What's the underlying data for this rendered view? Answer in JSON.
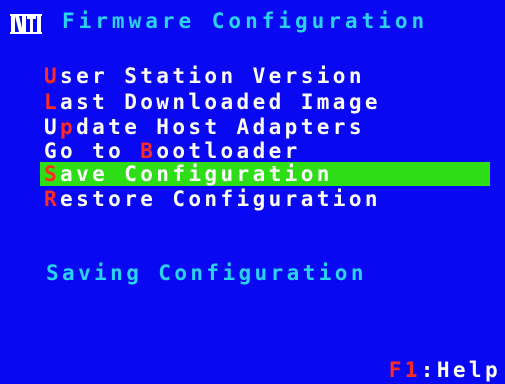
{
  "header": {
    "logo_text": "NTI",
    "title": "Firmware Configuration"
  },
  "menu": {
    "items": [
      {
        "hotkey": "U",
        "rest": "ser Station Version",
        "selected": false
      },
      {
        "hotkey": "L",
        "rest": "ast Downloaded Image",
        "selected": false
      },
      {
        "prefix": "U",
        "hotkey": "p",
        "rest": "date Host Adapters",
        "selected": false
      },
      {
        "prefix": "Go to ",
        "hotkey": "B",
        "rest": "ootloader",
        "selected": false
      },
      {
        "hotkey": "S",
        "rest": "ave Configuration",
        "selected": true
      },
      {
        "hotkey": "R",
        "rest": "estore Configuration",
        "selected": false
      }
    ]
  },
  "status": {
    "message": "Saving Configuration"
  },
  "footer": {
    "help_key": "F1",
    "help_label": ":Help"
  },
  "colors": {
    "background": "#0808f2",
    "title": "#2ad3f6",
    "menu_text": "#ffffff",
    "hotkey": "#ff2a24",
    "highlight": "#2dde16"
  }
}
